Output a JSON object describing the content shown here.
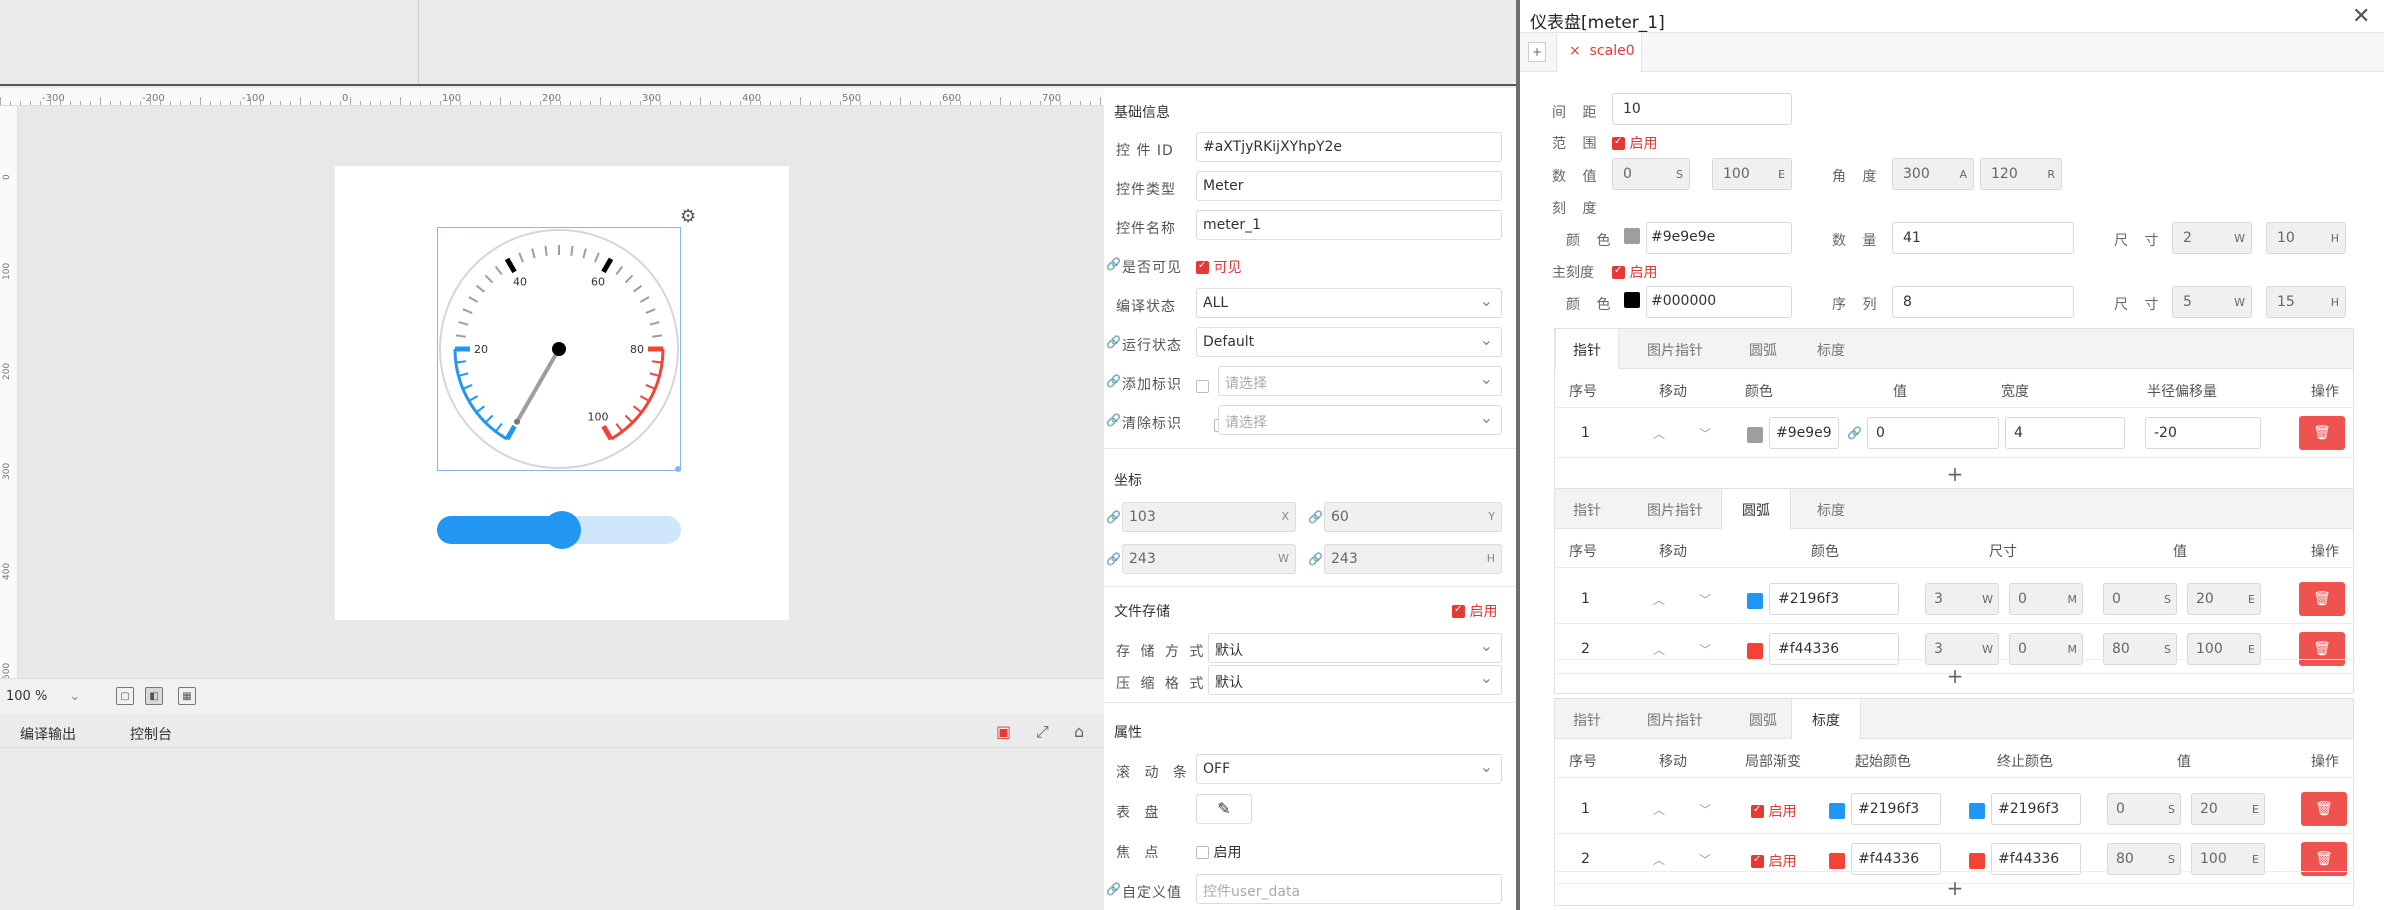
{
  "ruler": {
    "top_ticks": [
      "-300",
      "-200",
      "-100",
      "0",
      "100",
      "200",
      "300",
      "400",
      "500",
      "600",
      "700"
    ],
    "left_ticks": [
      "0",
      "100",
      "200",
      "300",
      "400",
      "500"
    ]
  },
  "meter": {
    "labels": [
      "20",
      "40",
      "60",
      "80",
      "100"
    ],
    "value": 0,
    "range": [
      0,
      100
    ],
    "slider_value": 50
  },
  "statusbar": {
    "zoom": "100 %"
  },
  "bottom_tabs": [
    "编译输出",
    "控制台"
  ],
  "props": {
    "basic_title": "基础信息",
    "fields": [
      {
        "label": "控 件 ID",
        "value": "#aXTjyRKijXYhpY2e"
      },
      {
        "label": "控件类型",
        "value": "Meter"
      },
      {
        "label": "控件名称",
        "value": "meter_1"
      }
    ],
    "visible_label": "是否可见",
    "visible_value": "可见",
    "compile_label": "编译状态",
    "compile_value": "ALL",
    "run_label": "运行状态",
    "run_value": "Default",
    "add_flag_label": "添加标识",
    "clear_flag_label": "清除标识",
    "select_placeholder": "请选择",
    "coord_title": "坐标",
    "x": "103",
    "y": "60",
    "w": "243",
    "h": "243",
    "x_sfx": "X",
    "y_sfx": "Y",
    "w_sfx": "W",
    "h_sfx": "H",
    "file_title": "文件存储",
    "enable": "启用",
    "storage_label": "存 储 方 式",
    "storage_value": "默认",
    "compress_label": "压 缩 格 式",
    "compress_value": "默认",
    "attr_title": "属性",
    "scroll_label": "滚 动 条",
    "scroll_value": "OFF",
    "dial_label": "表  盘",
    "focus_label": "焦  点",
    "focus_value": "启用",
    "custom_label": "自定义值",
    "custom_placeholder": "控件user_data"
  },
  "dialog": {
    "title": "仪表盘[meter_1]",
    "plus": "+",
    "scale_tab": "scale0",
    "spacing_label": "间 距",
    "spacing_value": "10",
    "range_label": "范 围",
    "enable": "启用",
    "value_label": "数 值",
    "value_min": "0",
    "value_min_sfx": "S",
    "value_max": "100",
    "value_max_sfx": "E",
    "angle_label": "角 度",
    "angle_a": "300",
    "angle_a_sfx": "A",
    "angle_r": "120",
    "angle_r_sfx": "R",
    "tick_label": "刻 度",
    "color_label": "颜 色",
    "tick_color": "#9e9e9e",
    "count_label": "数 量",
    "count_value": "41",
    "size_label": "尺 寸",
    "tick_w": "2",
    "tick_h": "10",
    "major_label": "主刻度",
    "major_color": "#000000",
    "seq_label": "序 列",
    "seq_value": "8",
    "major_w": "5",
    "major_h": "15",
    "w_sfx": "W",
    "h_sfx": "H",
    "m_sfx": "M",
    "s_sfx": "S",
    "e_sfx": "E",
    "subtabs": [
      "指针",
      "图片指针",
      "圆弧",
      "标度"
    ],
    "needle": {
      "headers": [
        "序号",
        "移动",
        "颜色",
        "值",
        "宽度",
        "半径偏移量",
        "操作"
      ],
      "rows": [
        {
          "idx": "1",
          "color": "#9e9e9e",
          "color_text": "#9e9e9",
          "value": "0",
          "width": "4",
          "offset": "-20"
        }
      ]
    },
    "arc": {
      "headers": [
        "序号",
        "移动",
        "颜色",
        "尺寸",
        "值",
        "操作"
      ],
      "rows": [
        {
          "idx": "1",
          "color": "#2196f3",
          "w": "3",
          "m": "0",
          "s": "0",
          "e": "20"
        },
        {
          "idx": "2",
          "color": "#f44336",
          "w": "3",
          "m": "0",
          "s": "80",
          "e": "100"
        }
      ]
    },
    "scalearc": {
      "headers": [
        "序号",
        "移动",
        "局部渐变",
        "起始颜色",
        "终止颜色",
        "值",
        "操作"
      ],
      "rows": [
        {
          "idx": "1",
          "grad": "启用",
          "c1": "#2196f3",
          "c2": "#2196f3",
          "s": "0",
          "e": "20"
        },
        {
          "idx": "2",
          "grad": "启用",
          "c1": "#f44336",
          "c2": "#f44336",
          "s": "80",
          "e": "100"
        }
      ]
    },
    "add": "+"
  },
  "colors": {
    "accent": "#e53935",
    "blue": "#2196f3",
    "red": "#f44336",
    "grey": "#9e9e9e"
  }
}
